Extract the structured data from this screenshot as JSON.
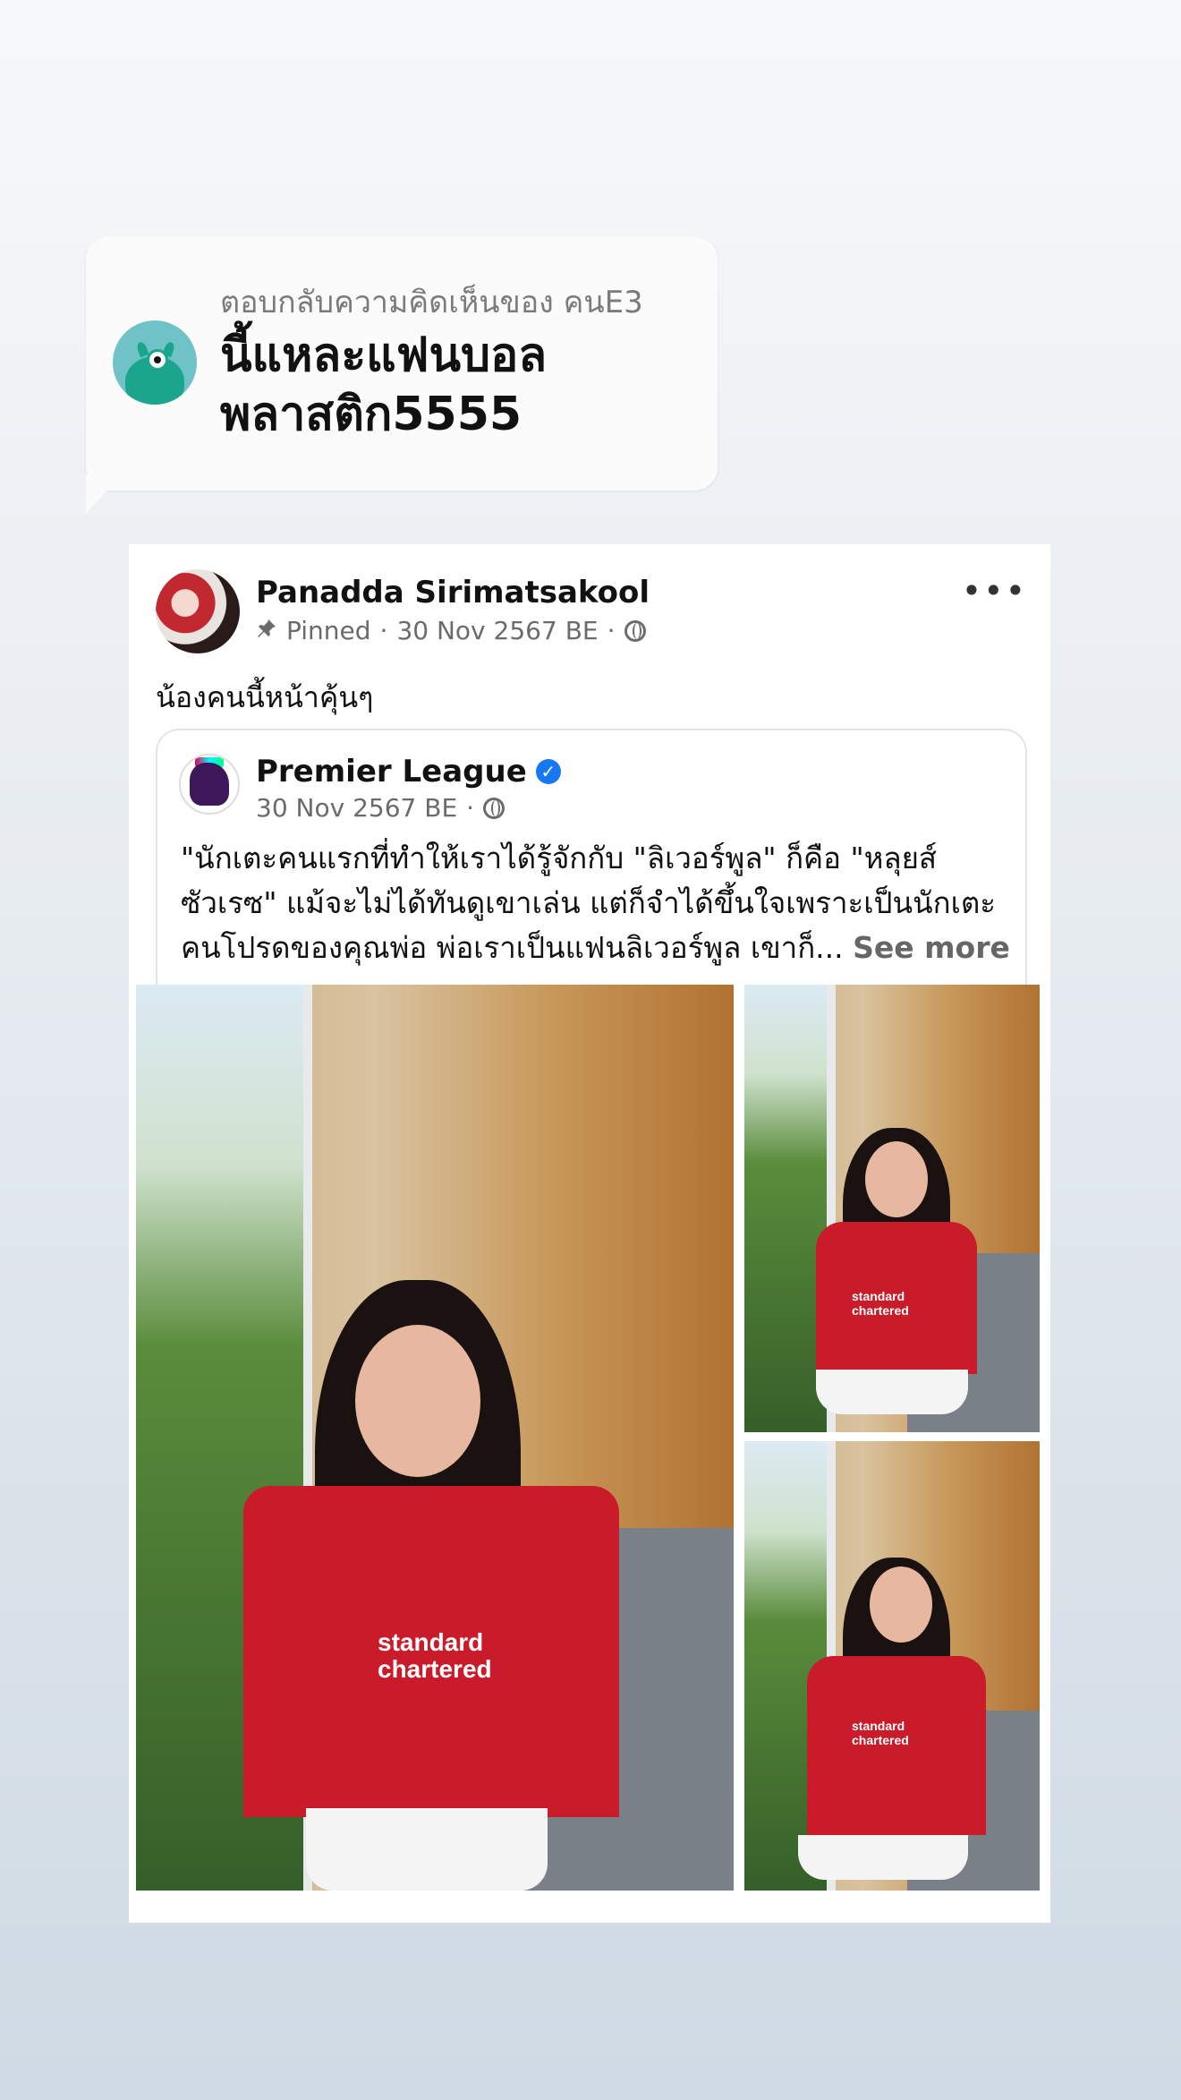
{
  "reply": {
    "label": "ตอบกลับความคิดเห็นของ คนE3",
    "text": "นี้แหละแฟนบอล พลาสติก5555",
    "avatar": "monster-avatar-icon"
  },
  "post": {
    "author": "Panadda Sirimatsakool",
    "pinned_label": "Pinned",
    "date": "30 Nov 2567 BE",
    "separator": "·",
    "more": "•••",
    "text": "น้องคนนี้หน้าคุ้นๆ",
    "icons": [
      "pin-icon",
      "globe-icon",
      "more-icon"
    ]
  },
  "shared": {
    "page_name": "Premier League",
    "verified_mark": "✓",
    "date": "30 Nov 2567 BE",
    "separator": "·",
    "text": "\"นักเตะคนแรกที่ทำให้เราได้รู้จักกับ \"ลิเวอร์พูล\" ก็คือ \"หลุยส์ ซัวเรซ\" แม้จะไม่ได้ทันดูเขาเล่น แต่ก็จำได้ขึ้นใจเพราะเป็นนักเตะคนโปรดของคุณพ่อ พ่อเราเป็นแฟนลิเวอร์พูล เขาก็...",
    "see_more": "See more"
  },
  "photos": {
    "sponsor_line1": "standard",
    "sponsor_line2": "chartered"
  },
  "colors": {
    "jersey": "#c91b2a",
    "verified": "#1877f2",
    "pl_purple": "#3d195b"
  }
}
